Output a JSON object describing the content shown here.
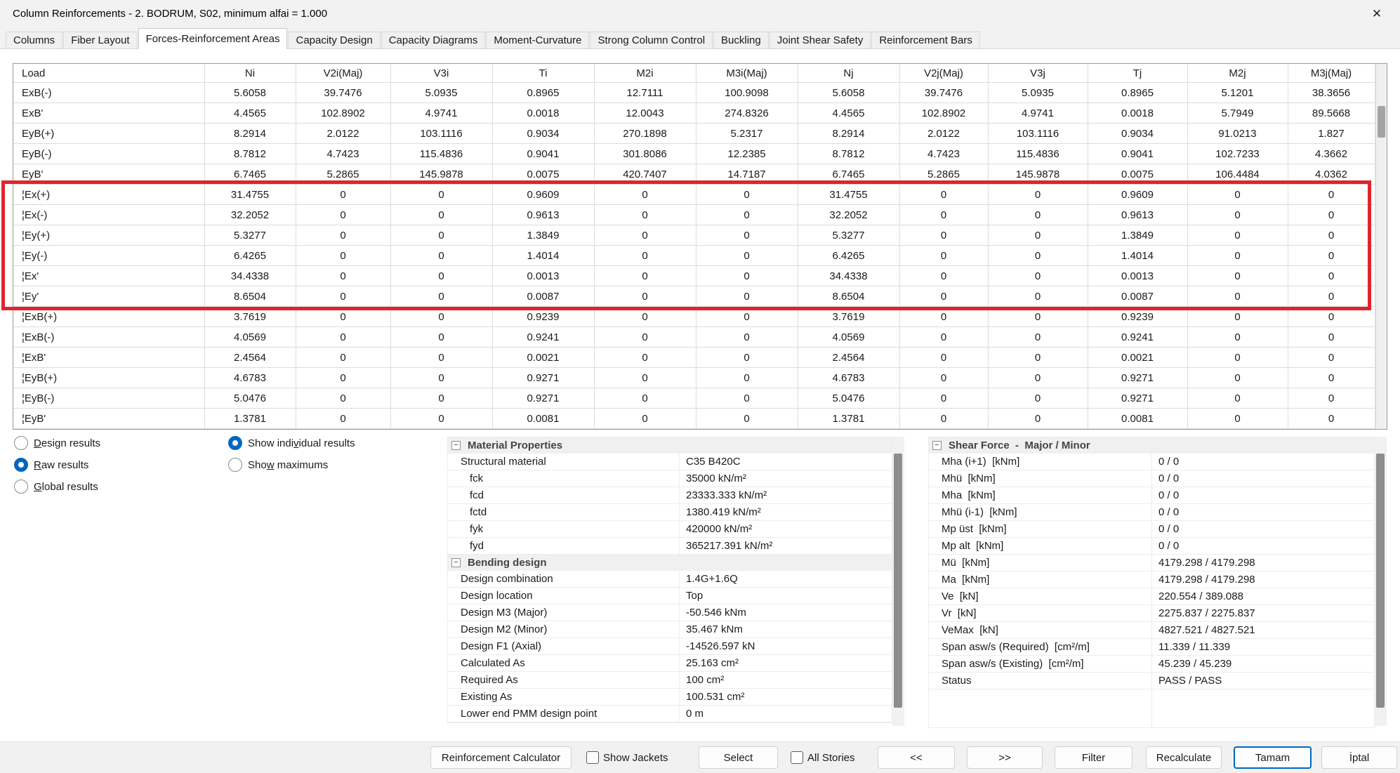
{
  "window": {
    "title": "Column Reinforcements - 2. BODRUM, S02, minimum alfai = 1.000"
  },
  "icons": {
    "close": "✕",
    "collapse": "−"
  },
  "colors": {
    "accent_blue": "#0067c0",
    "highlight_red": "#e0242c",
    "panel_header_bg": "#f0f0f0"
  },
  "tabs": [
    {
      "label": "Columns",
      "active": false
    },
    {
      "label": "Fiber Layout",
      "active": false
    },
    {
      "label": "Forces-Reinforcement Areas",
      "active": true
    },
    {
      "label": "Capacity Design",
      "active": false
    },
    {
      "label": "Capacity Diagrams",
      "active": false
    },
    {
      "label": "Moment-Curvature",
      "active": false
    },
    {
      "label": "Strong Column Control",
      "active": false
    },
    {
      "label": "Buckling",
      "active": false
    },
    {
      "label": "Joint Shear Safety",
      "active": false
    },
    {
      "label": "Reinforcement Bars",
      "active": false
    }
  ],
  "table": {
    "columns": [
      "Load",
      "Ni",
      "V2i(Maj)",
      "V3i",
      "Ti",
      "M2i",
      "M3i(Maj)",
      "Nj",
      "V2j(Maj)",
      "V3j",
      "Tj",
      "M2j",
      "M3j(Maj)"
    ],
    "rows": [
      {
        "load": "ExB(-)",
        "values": [
          "5.6058",
          "39.7476",
          "5.0935",
          "0.8965",
          "12.7111",
          "100.9098",
          "5.6058",
          "39.7476",
          "5.0935",
          "0.8965",
          "5.1201",
          "38.3656"
        ]
      },
      {
        "load": "ExB'",
        "values": [
          "4.4565",
          "102.8902",
          "4.9741",
          "0.0018",
          "12.0043",
          "274.8326",
          "4.4565",
          "102.8902",
          "4.9741",
          "0.0018",
          "5.7949",
          "89.5668"
        ]
      },
      {
        "load": "EyB(+)",
        "values": [
          "8.2914",
          "2.0122",
          "103.1116",
          "0.9034",
          "270.1898",
          "5.2317",
          "8.2914",
          "2.0122",
          "103.1116",
          "0.9034",
          "91.0213",
          "1.827"
        ]
      },
      {
        "load": "EyB(-)",
        "values": [
          "8.7812",
          "4.7423",
          "115.4836",
          "0.9041",
          "301.8086",
          "12.2385",
          "8.7812",
          "4.7423",
          "115.4836",
          "0.9041",
          "102.7233",
          "4.3662"
        ]
      },
      {
        "load": "EyB'",
        "values": [
          "6.7465",
          "5.2865",
          "145.9878",
          "0.0075",
          "420.7407",
          "14.7187",
          "6.7465",
          "5.2865",
          "145.9878",
          "0.0075",
          "106.4484",
          "4.0362"
        ]
      },
      {
        "load": "¦Ex(+)",
        "values": [
          "31.4755",
          "0",
          "0",
          "0.9609",
          "0",
          "0",
          "31.4755",
          "0",
          "0",
          "0.9609",
          "0",
          "0"
        ]
      },
      {
        "load": "¦Ex(-)",
        "values": [
          "32.2052",
          "0",
          "0",
          "0.9613",
          "0",
          "0",
          "32.2052",
          "0",
          "0",
          "0.9613",
          "0",
          "0"
        ]
      },
      {
        "load": "¦Ey(+)",
        "values": [
          "5.3277",
          "0",
          "0",
          "1.3849",
          "0",
          "0",
          "5.3277",
          "0",
          "0",
          "1.3849",
          "0",
          "0"
        ]
      },
      {
        "load": "¦Ey(-)",
        "values": [
          "6.4265",
          "0",
          "0",
          "1.4014",
          "0",
          "0",
          "6.4265",
          "0",
          "0",
          "1.4014",
          "0",
          "0"
        ]
      },
      {
        "load": "¦Ex'",
        "values": [
          "34.4338",
          "0",
          "0",
          "0.0013",
          "0",
          "0",
          "34.4338",
          "0",
          "0",
          "0.0013",
          "0",
          "0"
        ]
      },
      {
        "load": "¦Ey'",
        "values": [
          "8.6504",
          "0",
          "0",
          "0.0087",
          "0",
          "0",
          "8.6504",
          "0",
          "0",
          "0.0087",
          "0",
          "0"
        ]
      },
      {
        "load": "¦ExB(+)",
        "values": [
          "3.7619",
          "0",
          "0",
          "0.9239",
          "0",
          "0",
          "3.7619",
          "0",
          "0",
          "0.9239",
          "0",
          "0"
        ]
      },
      {
        "load": "¦ExB(-)",
        "values": [
          "4.0569",
          "0",
          "0",
          "0.9241",
          "0",
          "0",
          "4.0569",
          "0",
          "0",
          "0.9241",
          "0",
          "0"
        ]
      },
      {
        "load": "¦ExB'",
        "values": [
          "2.4564",
          "0",
          "0",
          "0.0021",
          "0",
          "0",
          "2.4564",
          "0",
          "0",
          "0.0021",
          "0",
          "0"
        ]
      },
      {
        "load": "¦EyB(+)",
        "values": [
          "4.6783",
          "0",
          "0",
          "0.9271",
          "0",
          "0",
          "4.6783",
          "0",
          "0",
          "0.9271",
          "0",
          "0"
        ]
      },
      {
        "load": "¦EyB(-)",
        "values": [
          "5.0476",
          "0",
          "0",
          "0.9271",
          "0",
          "0",
          "5.0476",
          "0",
          "0",
          "0.9271",
          "0",
          "0"
        ]
      },
      {
        "load": "¦EyB'",
        "values": [
          "1.3781",
          "0",
          "0",
          "0.0081",
          "0",
          "0",
          "1.3781",
          "0",
          "0",
          "0.0081",
          "0",
          "0"
        ]
      }
    ],
    "highlighted_rows": [
      "¦Ex(+)",
      "¦Ex(-)",
      "¦Ey(+)",
      "¦Ey(-)",
      "¦Ex'",
      "¦Ey'"
    ]
  },
  "options": {
    "left": [
      {
        "name": "radio-design-results",
        "html": "<u>D</u>esign results",
        "selected": false
      },
      {
        "name": "radio-raw-results",
        "html": "<u>R</u>aw results",
        "selected": true
      },
      {
        "name": "radio-global-results",
        "html": "<u>G</u>lobal results",
        "selected": false
      }
    ],
    "right": [
      {
        "name": "radio-show-individual-results",
        "html": "Show indi<u>v</u>idual results",
        "selected": true
      },
      {
        "name": "radio-show-maximums",
        "html": "Sho<u>w</u> maximums",
        "selected": false
      }
    ]
  },
  "panels": {
    "left": {
      "groups": [
        {
          "title": "Material Properties",
          "rows": [
            {
              "label": "Structural material",
              "value": "C35 B420C",
              "indent": false
            },
            {
              "label": "fck",
              "value": "35000 kN/m²",
              "indent": true
            },
            {
              "label": "fcd",
              "value": "23333.333 kN/m²",
              "indent": true
            },
            {
              "label": "fctd",
              "value": "1380.419 kN/m²",
              "indent": true
            },
            {
              "label": "fyk",
              "value": "420000 kN/m²",
              "indent": true
            },
            {
              "label": "fyd",
              "value": "365217.391 kN/m²",
              "indent": true
            }
          ]
        },
        {
          "title": "Bending design",
          "rows": [
            {
              "label": "Design combination",
              "value": "1.4G+1.6Q",
              "indent": false
            },
            {
              "label": "Design location",
              "value": "Top",
              "indent": false
            },
            {
              "label": "Design M3 (Major)",
              "value": "-50.546 kNm",
              "indent": false
            },
            {
              "label": "Design M2 (Minor)",
              "value": "35.467 kNm",
              "indent": false
            },
            {
              "label": "Design F1 (Axial)",
              "value": "-14526.597 kN",
              "indent": false
            },
            {
              "label": "Calculated As",
              "value": "25.163 cm²",
              "indent": false
            },
            {
              "label": "Required As",
              "value": "100 cm²",
              "indent": false
            },
            {
              "label": "Existing As",
              "value": "100.531 cm²",
              "indent": false
            },
            {
              "label": "Lower end PMM design point",
              "value": "0 m",
              "indent": false
            }
          ]
        }
      ]
    },
    "right": {
      "groups": [
        {
          "title": "Shear Force  -  Major / Minor",
          "rows": [
            {
              "label": "Mha (i+1)  [kNm]",
              "value": "0 / 0",
              "indent": false
            },
            {
              "label": "Mhü  [kNm]",
              "value": "0 / 0",
              "indent": false
            },
            {
              "label": "Mha  [kNm]",
              "value": "0 / 0",
              "indent": false
            },
            {
              "label": "Mhü (i-1)  [kNm]",
              "value": "0 / 0",
              "indent": false
            },
            {
              "label": "Mp üst  [kNm]",
              "value": "0 / 0",
              "indent": false
            },
            {
              "label": "Mp alt  [kNm]",
              "value": "0 / 0",
              "indent": false
            },
            {
              "label": "Mü  [kNm]",
              "value": "4179.298 / 4179.298",
              "indent": false
            },
            {
              "label": "Ma  [kNm]",
              "value": "4179.298 / 4179.298",
              "indent": false
            },
            {
              "label": "Ve  [kN]",
              "value": "220.554 / 389.088",
              "indent": false
            },
            {
              "label": "Vr  [kN]",
              "value": "2275.837 / 2275.837",
              "indent": false
            },
            {
              "label": "VeMax  [kN]",
              "value": "4827.521 / 4827.521",
              "indent": false
            },
            {
              "label": "Span asw/s (Required)  [cm²/m]",
              "value": "11.339 / 11.339",
              "indent": false
            },
            {
              "label": "Span asw/s (Existing)  [cm²/m]",
              "value": "45.239 / 45.239",
              "indent": false
            },
            {
              "label": "Status",
              "value": "PASS / PASS",
              "indent": false
            }
          ]
        }
      ]
    }
  },
  "footer": {
    "reinforcement_calculator": "Reinforcement Calculator",
    "show_jackets": "Show Jackets",
    "select": "Select",
    "all_stories": "All Stories",
    "prev": "<<",
    "next": ">>",
    "filter": "Filter",
    "recalculate": "Recalculate",
    "ok": "Tamam",
    "cancel": "İptal"
  }
}
